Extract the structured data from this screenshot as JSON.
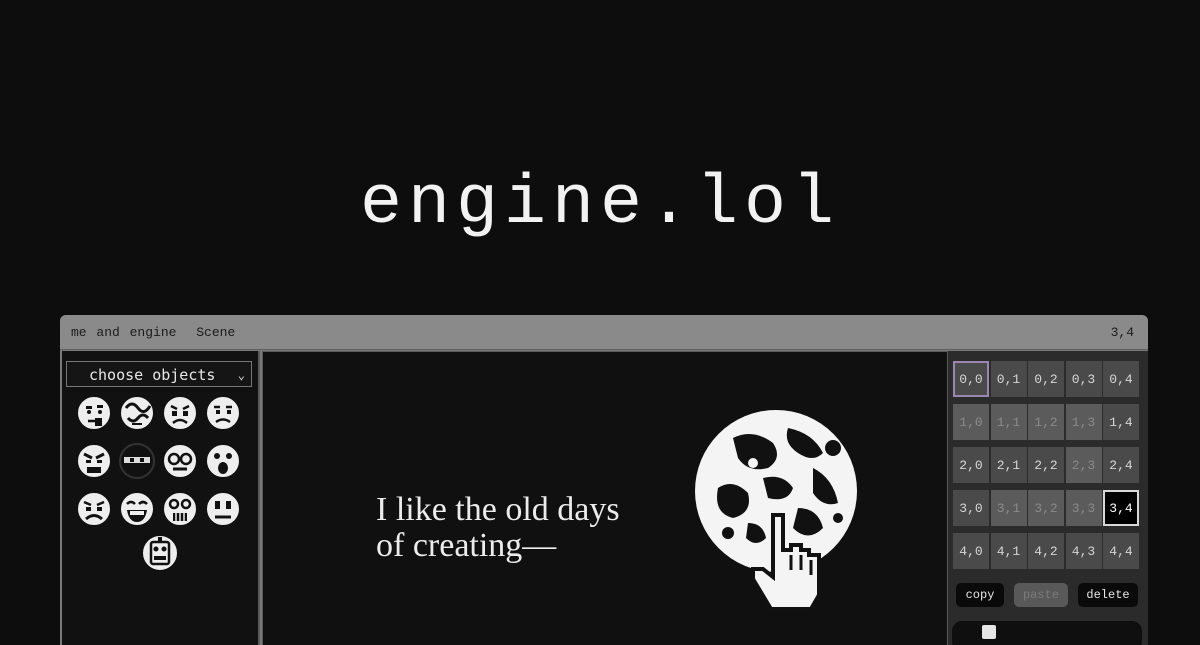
{
  "hero": {
    "title": "engine.lol"
  },
  "window": {
    "menu": [
      "me and engine",
      "Scene"
    ],
    "coord": "3,4"
  },
  "objects_panel": {
    "select_value": "choose objects",
    "faces": [
      "face-thinking",
      "face-scribble",
      "face-worried",
      "face-frown",
      "face-angry",
      "face-ninja",
      "face-glasses",
      "face-shocked",
      "face-grimace",
      "face-laughing",
      "face-scared",
      "face-neutral"
    ],
    "extra": "robot-face"
  },
  "canvas": {
    "quote_lines": [
      "I like the old days",
      "of creating—"
    ],
    "images": [
      "moon-image",
      "pointing-hand-cursor"
    ]
  },
  "scenes": {
    "cells": [
      [
        "0,0",
        "0,1",
        "0,2",
        "0,3",
        "0,4"
      ],
      [
        "1,0",
        "1,1",
        "1,2",
        "1,3",
        "1,4"
      ],
      [
        "2,0",
        "2,1",
        "2,2",
        "2,3",
        "2,4"
      ],
      [
        "3,0",
        "3,1",
        "3,2",
        "3,3",
        "3,4"
      ],
      [
        "4,0",
        "4,1",
        "4,2",
        "4,3",
        "4,4"
      ]
    ],
    "selected": "3,4",
    "buttons": {
      "copy": "copy",
      "paste": "paste",
      "delete": "delete"
    }
  },
  "colors": {
    "background": "#0d0d0d",
    "window": "#7a7a7a",
    "accent_border": "#9a86b0"
  }
}
